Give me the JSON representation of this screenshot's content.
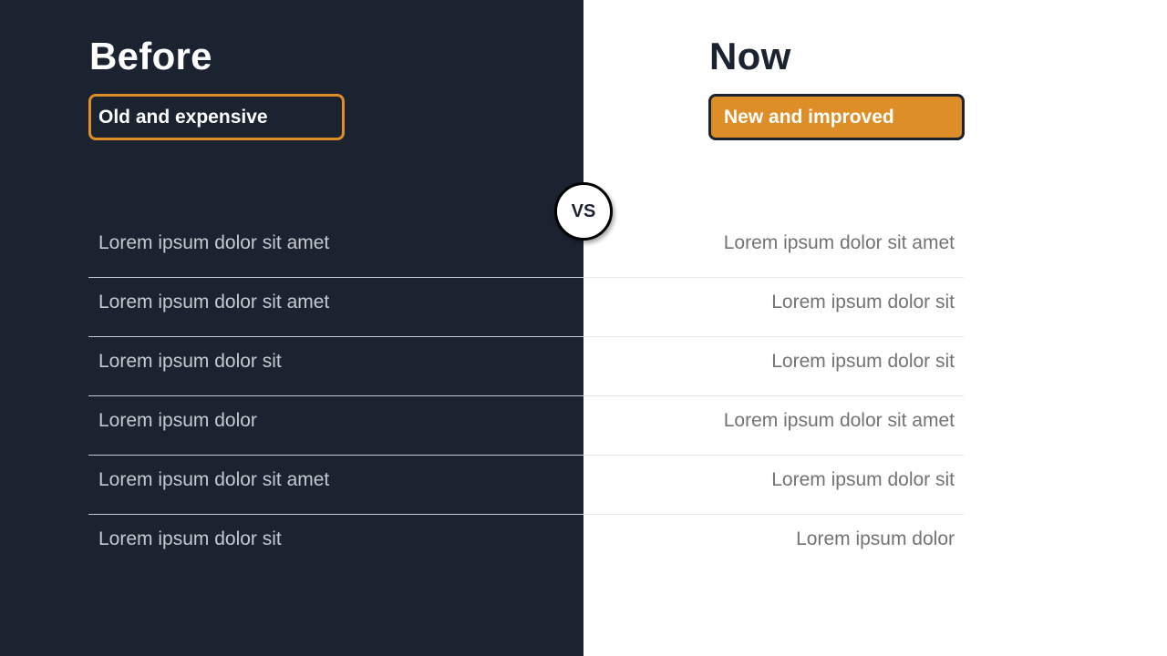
{
  "before": {
    "title": "Before",
    "badge": "Old and expensive",
    "items": [
      "Lorem ipsum dolor sit amet",
      "Lorem ipsum dolor sit amet",
      "Lorem ipsum dolor sit",
      "Lorem ipsum dolor",
      "Lorem ipsum dolor sit amet",
      "Lorem ipsum dolor sit"
    ]
  },
  "now": {
    "title": "Now",
    "badge": "New and improved",
    "items": [
      "Lorem ipsum dolor sit amet",
      "Lorem ipsum dolor sit",
      "Lorem ipsum dolor sit",
      "Lorem ipsum dolor sit amet",
      "Lorem ipsum dolor sit",
      "Lorem ipsum dolor"
    ]
  },
  "divider_label": "VS",
  "colors": {
    "dark": "#1b2331",
    "accent": "#de8e26",
    "light": "#ffffff"
  }
}
